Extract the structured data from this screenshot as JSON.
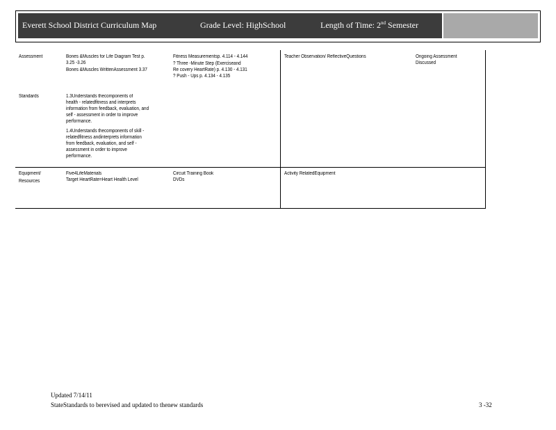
{
  "header": {
    "district": "Everett   School  District  Curriculum   Map",
    "grade": "Grade   Level:  HighSchool",
    "length_prefix": "Length   of  Time:  2",
    "length_sup": "nd",
    "length_suffix": " Semester"
  },
  "rows": {
    "assessment": {
      "label": "Assessment",
      "col1": [
        "Bones   &Muscles    for Life  Diagram    Test  p.",
        "3.25  -3.26",
        "Bones   &Muscles    WrittenAssessment      3.37"
      ],
      "col2": [
        "Fitness   Measurementsp.         4.114   - 4.144",
        "?       Three  -Minute   Step  (Exerciseand",
        "        Re covery  HeartRate)     p.  4.130   - 4.131",
        "?       Push  - Ups  p.  4.134  - 4.135"
      ],
      "col3": "Teacher   Observation/      ReflectiveQuestions",
      "col4": [
        "Ongoing     Assessment",
        "Discussed"
      ]
    },
    "standards": {
      "label": "Standards",
      "col1a": [
        "1.3Understands          thecomponents        of",
        "health  - relatedfitness      and   interprets",
        "information    from  feedback,    evaluation,     and",
        "self - assessment      in  order   to  improve",
        "performance."
      ],
      "col1b": [
        "1.4Understands          thecomponents        of  skill   -",
        "relatedfitness      andinterprets      information",
        "from  feedback,    evaluation,    and   self -",
        "assessment      in  order   to  improve",
        "performance."
      ]
    },
    "equipment": {
      "label_line1": "Equipment/",
      "label_line2": "Resources",
      "col1": [
        "Five4LifeMaterials",
        "Target    HeartRate=Heart         Health    Level"
      ],
      "col2": [
        "Circuit    Training    Book",
        "DVDs"
      ],
      "col3": "Activity   RelatedEquipment"
    }
  },
  "footer": {
    "updated": "Updated     7/14/11",
    "note": "StateStandards         to  berevised      and  updated       to  thenew    standards",
    "page": "3 -32"
  }
}
